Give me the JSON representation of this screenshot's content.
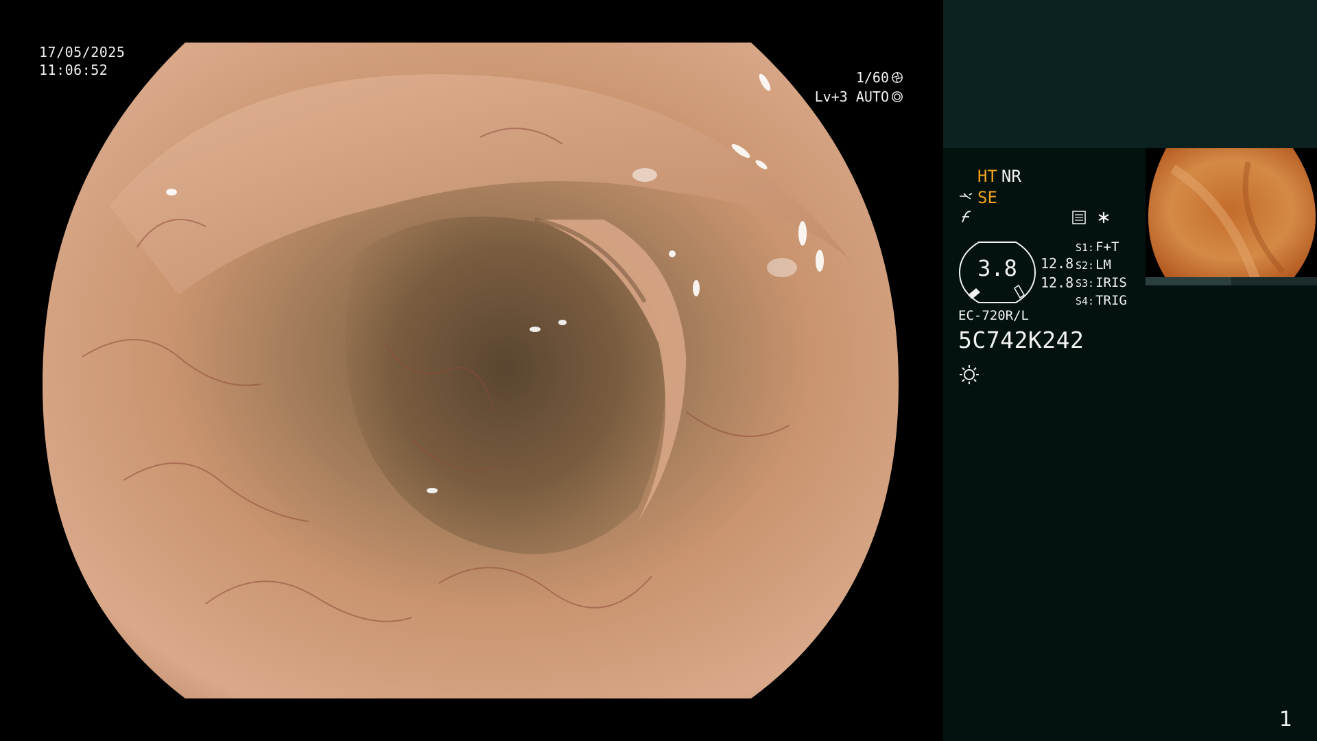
{
  "overlay": {
    "date": "17/05/2025",
    "time": "11:06:52",
    "shutter_speed": "1/60",
    "light_level": "Lv+3 AUTO"
  },
  "panel": {
    "mode_ht": "HT",
    "mode_nr": "NR",
    "mode_se": "SE",
    "gauge_value": "3.8",
    "gain_1": "12.8",
    "gain_2": "12.8",
    "switches": [
      {
        "key": "S1:",
        "value": "F+T"
      },
      {
        "key": "S2:",
        "value": "LM"
      },
      {
        "key": "S3:",
        "value": "IRIS"
      },
      {
        "key": "S4:",
        "value": "TRIG"
      }
    ],
    "scope_model": "EC-720R/L",
    "serial_number": "5C742K242",
    "page_number": "1"
  },
  "colors": {
    "panel_bg": "#03120f",
    "panel_top_bg": "#0c2220",
    "accent_orange": "#f5a21c",
    "text": "#f2f2f2"
  },
  "icons": [
    "shutter-icon",
    "auto-exposure-icon",
    "scope-bend-icon",
    "hook-icon",
    "memory-icon",
    "asterisk-icon",
    "sun-icon"
  ]
}
